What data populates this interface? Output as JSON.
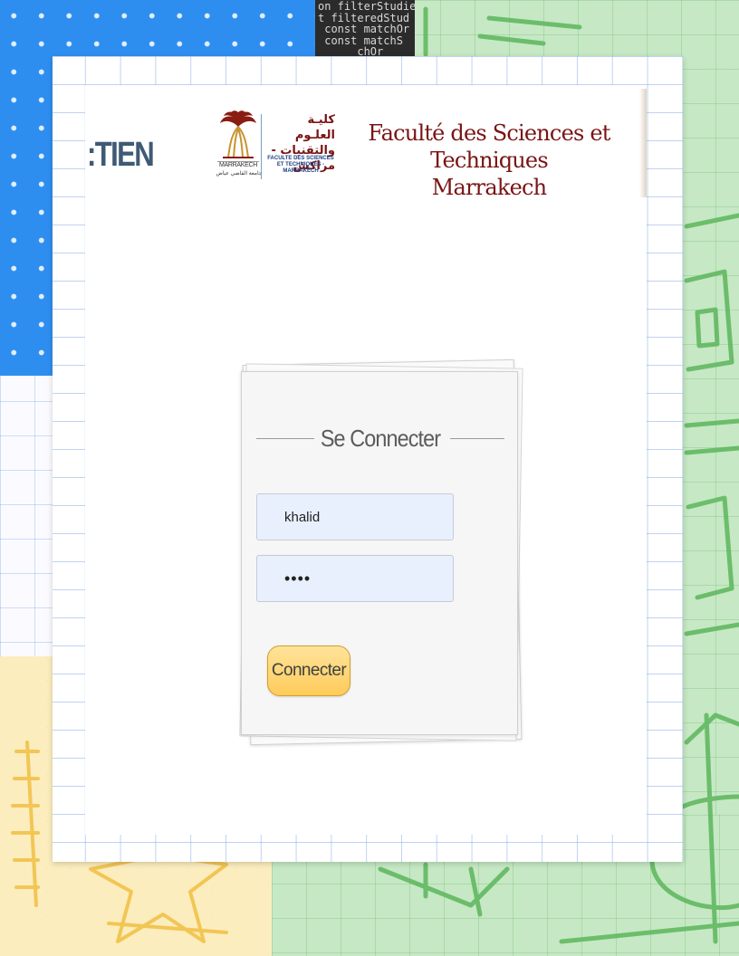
{
  "background": {
    "code_lines": [
      "on filterStudie",
      "t filteredStud",
      " const matchOr",
      " const matchS",
      "      chOr"
    ]
  },
  "header": {
    "left_fragment": ":TIEN",
    "logo": {
      "arabic_name_line1": "كليـة العلـوم",
      "arabic_name_line2": "والتقنيات - مراكش",
      "french_name_line1": "FACULTE DES SCIENCES",
      "french_name_line2": "ET TECHNIQUES - MARRAKECH",
      "city": "MARRAKECH",
      "university_arabic": "جامعة القاضي عياض"
    },
    "title_line1": "Faculté des Sciences et Techniques",
    "title_line2": "Marrakech"
  },
  "login": {
    "title": "Se Connecter",
    "username_value": "khalid",
    "password_value": "••••",
    "submit_label": "Connecter"
  },
  "colors": {
    "brand_maroon": "#7a1414",
    "button_yellow": "#ffcb5a",
    "input_fill": "#e8f0fe",
    "accent_blue": "#2e8ef0"
  }
}
